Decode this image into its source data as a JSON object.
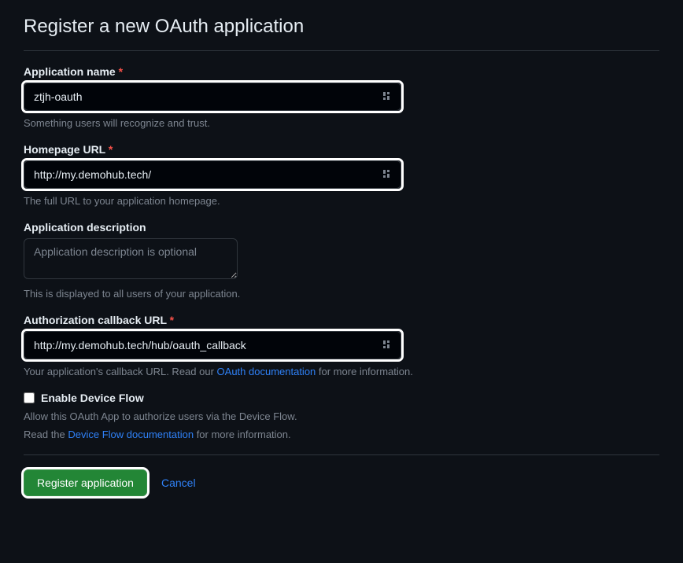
{
  "page": {
    "title": "Register a new OAuth application"
  },
  "fields": {
    "app_name": {
      "label": "Application name",
      "value": "ztjh-oauth",
      "help": "Something users will recognize and trust."
    },
    "homepage_url": {
      "label": "Homepage URL",
      "value": "http://my.demohub.tech/",
      "help": "The full URL to your application homepage."
    },
    "description": {
      "label": "Application description",
      "placeholder": "Application description is optional",
      "help": "This is displayed to all users of your application."
    },
    "callback_url": {
      "label": "Authorization callback URL",
      "value": "http://my.demohub.tech/hub/oauth_callback",
      "help_prefix": "Your application's callback URL. Read our ",
      "help_link": "OAuth documentation",
      "help_suffix": " for more information."
    },
    "device_flow": {
      "label": "Enable Device Flow",
      "help_line1": "Allow this OAuth App to authorize users via the Device Flow.",
      "help_line2_prefix": "Read the ",
      "help_line2_link": "Device Flow documentation",
      "help_line2_suffix": " for more information."
    }
  },
  "actions": {
    "register": "Register application",
    "cancel": "Cancel"
  }
}
